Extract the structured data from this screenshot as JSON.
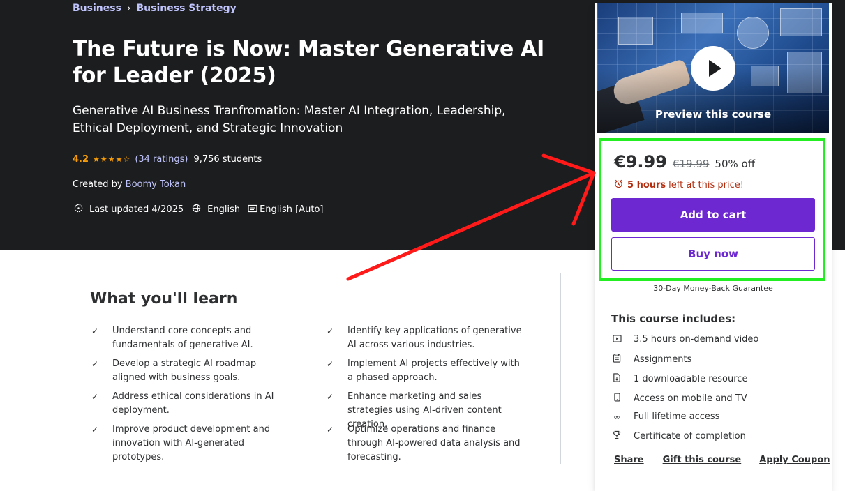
{
  "breadcrumb": {
    "items": [
      "Business",
      "Business Strategy"
    ],
    "separator": "›"
  },
  "course": {
    "title": "The Future is Now: Master Generative AI for Leader (2025)",
    "subtitle": "Generative AI Business Tranfromation: Master AI Integration, Leadership, Ethical Deployment, and Strategic Innovation",
    "rating": "4.2",
    "stars": "★★★★☆",
    "ratings_count": "(34 ratings)",
    "students": "9,756 students",
    "created_by_label": "Created by",
    "author": "Boomy Tokan",
    "last_updated": "Last updated 4/2025",
    "language": "English",
    "captions": "English [Auto]"
  },
  "learn": {
    "heading": "What you'll learn",
    "items": [
      "Understand core concepts and fundamentals of generative AI.",
      "Identify key applications of generative AI across various industries.",
      "Develop a strategic AI roadmap aligned with business goals.",
      "Implement AI projects effectively with a phased approach.",
      "Address ethical considerations in AI deployment.",
      "Enhance marketing and sales strategies using AI-driven content creation.",
      "Improve product development and innovation with AI-generated prototypes.",
      "Optimize operations and finance through AI-powered data analysis and forecasting."
    ]
  },
  "sidebar": {
    "preview_label": "Preview this course",
    "price": "€9.99",
    "old_price": "€19.99",
    "discount": "50% off",
    "timer_bold": "5 hours",
    "timer_rest": "left at this price!",
    "add_to_cart": "Add to cart",
    "buy_now": "Buy now",
    "guarantee": "30-Day Money-Back Guarantee",
    "includes_title": "This course includes:",
    "includes": [
      {
        "icon": "video-icon",
        "label": "3.5 hours on-demand video"
      },
      {
        "icon": "assignment-icon",
        "label": "Assignments"
      },
      {
        "icon": "download-file-icon",
        "label": "1 downloadable resource"
      },
      {
        "icon": "mobile-icon",
        "label": "Access on mobile and TV"
      },
      {
        "icon": "infinity-icon",
        "label": "Full lifetime access"
      },
      {
        "icon": "trophy-icon",
        "label": "Certificate of completion"
      }
    ],
    "links": [
      "Share",
      "Gift this course",
      "Apply Coupon"
    ]
  },
  "colors": {
    "accent": "#6d28d2",
    "highlight": "#22ee22",
    "annotation": "#ff1a1a",
    "hero_bg": "#1c1d1f"
  }
}
